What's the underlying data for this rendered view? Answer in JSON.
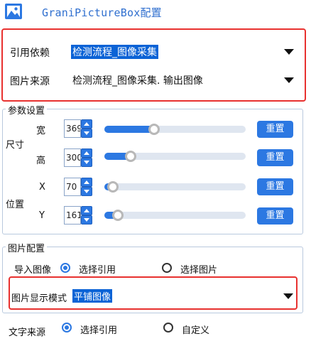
{
  "window": {
    "title": "GraniPictureBox配置"
  },
  "source": {
    "ref_label": "引用依赖",
    "ref_value": "检测流程_图像采集",
    "image_label": "图片来源",
    "image_value": "检测流程_图像采集. 输出图像"
  },
  "params": {
    "title": "参数设置",
    "size_label": "尺寸",
    "pos_label": "位置",
    "reset_label": "重置",
    "width": {
      "label": "宽",
      "value": "369",
      "fraction": 0.34
    },
    "height": {
      "label": "高",
      "value": "300",
      "fraction": 0.16
    },
    "x": {
      "label": "X",
      "value": "70",
      "fraction": 0.02
    },
    "y": {
      "label": "Y",
      "value": "161",
      "fraction": 0.06
    }
  },
  "image_config": {
    "title": "图片配置",
    "import_label": "导入图像",
    "option_ref": "选择引用",
    "option_pic": "选择图片",
    "display_mode_label": "图片显示模式",
    "display_mode_value": "平铺图像"
  },
  "text_source": {
    "label": "文字来源",
    "option_ref": "选择引用",
    "option_custom": "自定义"
  },
  "colors": {
    "accent": "#2c78e2",
    "highlight_box": "#e8312f",
    "title": "#2f6fcf"
  }
}
